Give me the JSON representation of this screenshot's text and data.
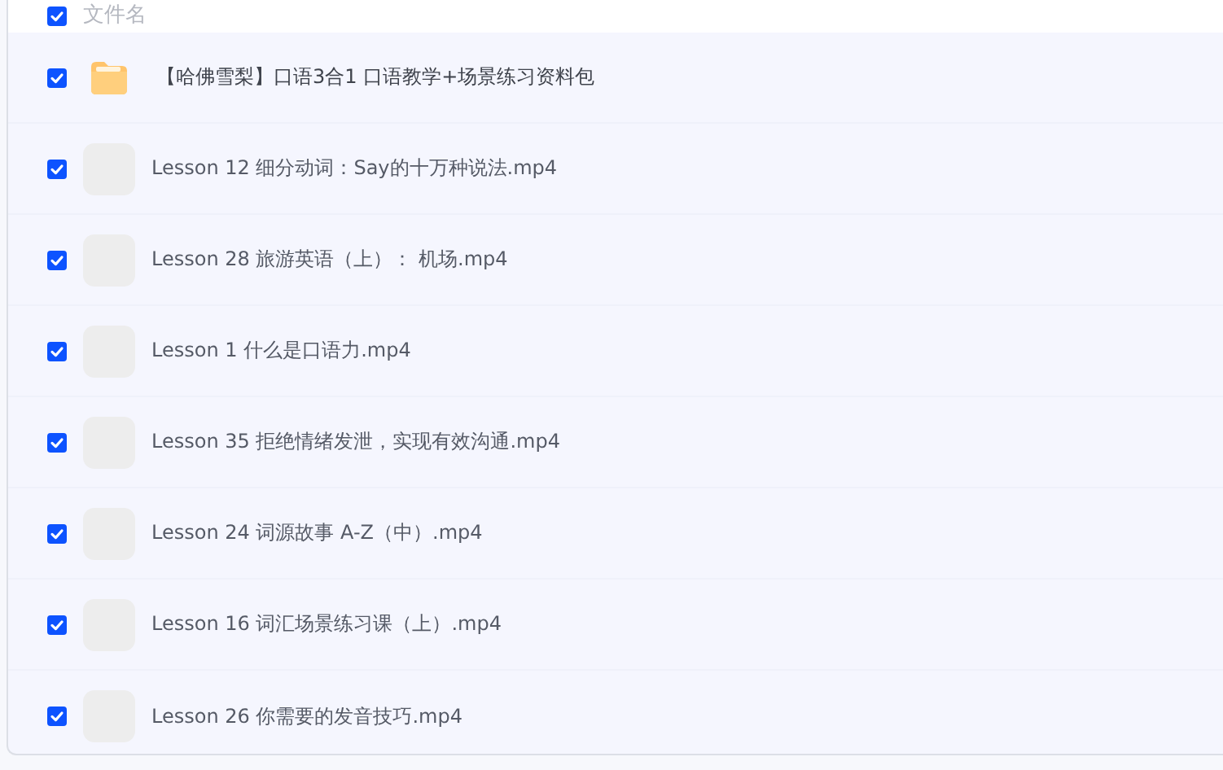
{
  "header": {
    "label": "文件名",
    "checked": true
  },
  "files": [
    {
      "kind": "folder",
      "name": "【哈佛雪梨】口语3合1 口语教学+场景练习资料包",
      "checked": true
    },
    {
      "kind": "video",
      "name": "Lesson 12 细分动词：Say的十万种说法.mp4",
      "checked": true
    },
    {
      "kind": "video",
      "name": "Lesson 28 旅游英语（上）： 机场.mp4",
      "checked": true
    },
    {
      "kind": "video",
      "name": "Lesson 1 什么是口语力.mp4",
      "checked": true
    },
    {
      "kind": "video",
      "name": "Lesson 35 拒绝情绪发泄，实现有效沟通.mp4",
      "checked": true
    },
    {
      "kind": "video",
      "name": "Lesson 24 词源故事 A-Z（中）.mp4",
      "checked": true
    },
    {
      "kind": "video",
      "name": "Lesson 16 词汇场景练习课（上）.mp4",
      "checked": true
    },
    {
      "kind": "video",
      "name": "Lesson 26 你需要的发音技巧.mp4",
      "checked": true
    }
  ]
}
